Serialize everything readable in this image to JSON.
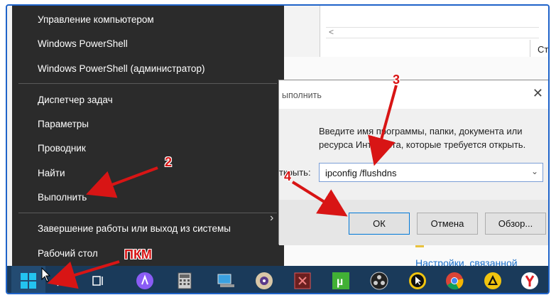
{
  "background": {
    "status_text": "Стр",
    "link_text": "Настройки, связанной"
  },
  "start_menu": {
    "items": [
      {
        "label": "Управление компьютером"
      },
      {
        "label": "Windows PowerShell"
      },
      {
        "label": "Windows PowerShell (администратор)"
      },
      {
        "label": "Диспетчер задач"
      },
      {
        "label": "Параметры"
      },
      {
        "label": "Проводник"
      },
      {
        "label": "Найти"
      },
      {
        "label": "Выполнить"
      },
      {
        "label": "Завершение работы или выход из системы"
      },
      {
        "label": "Рабочий стол"
      }
    ]
  },
  "run_dialog": {
    "title": "ыполнить",
    "description": "Введите имя программы, папки, документа или ресурса Интернета, которые требуется открыть.",
    "open_label": "ткрыть:",
    "input_value": "ipconfig /flushdns",
    "ok_label": "ОК",
    "cancel_label": "Отмена",
    "browse_label": "Обзор..."
  },
  "taskbar": {
    "icons": [
      "windows-start-icon",
      "search-icon",
      "task-view-icon",
      "alice-icon",
      "calculator-icon",
      "computer-icon",
      "disc-icon",
      "media-icon",
      "utorrent-icon",
      "obs-icon",
      "cursor-icon",
      "chrome-icon",
      "archive-icon",
      "yandex-browser-icon"
    ]
  },
  "annotations": {
    "step2": "2",
    "step3": "3",
    "step4": "4",
    "rmb": "ПКМ"
  },
  "colors": {
    "menu_bg": "#2b2b2b",
    "taskbar_bg": "#1a3a5a",
    "annotation": "#d81515",
    "accent_blue": "#0078d7"
  }
}
